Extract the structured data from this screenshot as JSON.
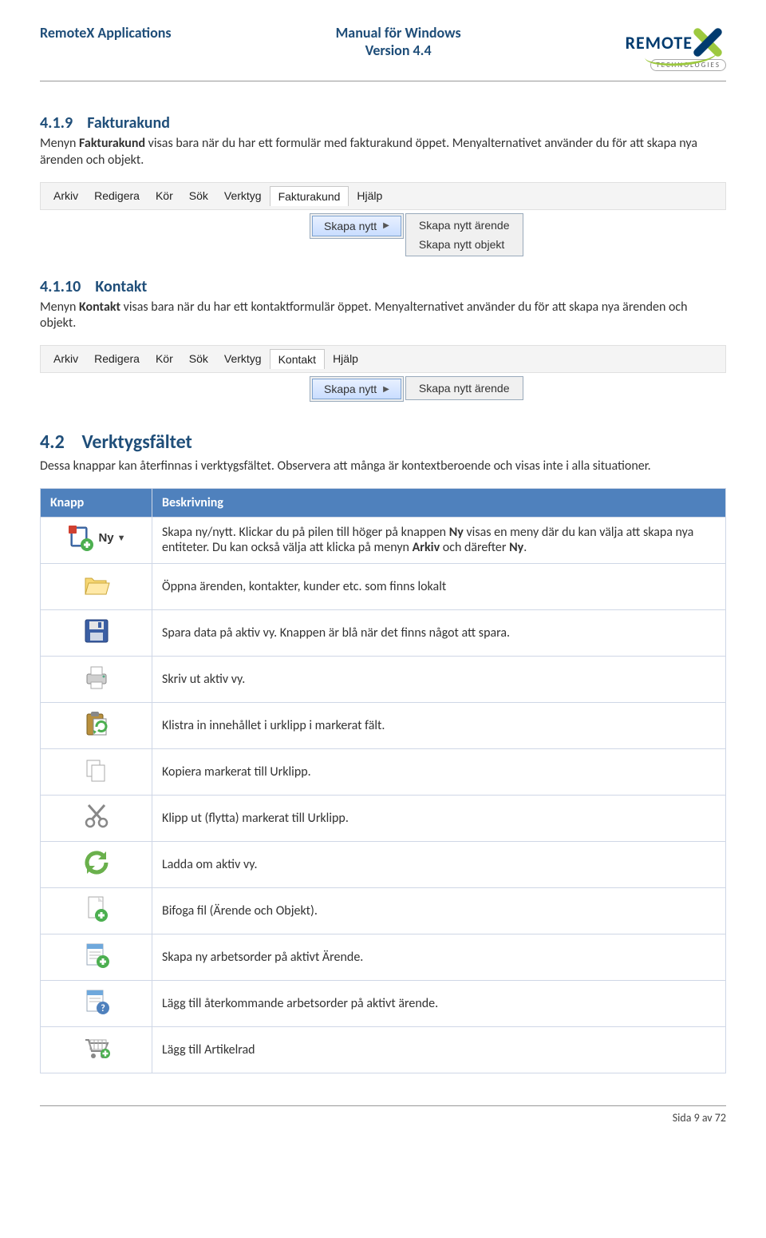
{
  "header": {
    "left": "RemoteX Applications",
    "center_line1": "Manual för Windows",
    "center_line2": "Version 4.4",
    "brand": "REMOTE",
    "brand_tag": "TECHNOLOGIES"
  },
  "sections": {
    "s1_num": "4.1.9",
    "s1_title": "Fakturakund",
    "s1_body_a": "Menyn ",
    "s1_body_b": "Fakturakund",
    "s1_body_c": " visas bara när du har ett formulär med fakturakund öppet. Menyalternativet använder du för att skapa nya ärenden och objekt.",
    "s2_num": "4.1.10",
    "s2_title": "Kontakt",
    "s2_body_a": "Menyn ",
    "s2_body_b": "Kontakt",
    "s2_body_c": " visas bara när du har ett kontaktformulär öppet. Menyalternativet använder du för att skapa nya ärenden och objekt.",
    "s3_num": "4.2",
    "s3_title": "Verktygsfältet",
    "s3_body": "Dessa knappar kan återfinnas i verktygsfältet. Observera att många är kontextberoende och visas inte i alla situationer."
  },
  "menus": {
    "items": [
      "Arkiv",
      "Redigera",
      "Kör",
      "Sök",
      "Verktyg"
    ],
    "fakturakund": "Fakturakund",
    "kontakt": "Kontakt",
    "hjalp": "Hjälp",
    "skapa_nytt": "Skapa nytt",
    "sub_arende": "Skapa nytt ärende",
    "sub_objekt": "Skapa nytt objekt"
  },
  "table": {
    "h1": "Knapp",
    "h2": "Beskrivning",
    "rows": [
      {
        "icon": "new",
        "label": "Ny",
        "text": "Skapa ny/nytt. Klickar du på pilen till höger på knappen ",
        "bold": "Ny",
        "text2": " visas en meny där du kan välja att skapa nya entiteter. Du kan också välja att klicka på menyn ",
        "bold2": "Arkiv",
        "text3": " och därefter ",
        "bold3": "Ny",
        "text4": "."
      },
      {
        "icon": "open",
        "text": "Öppna ärenden, kontakter, kunder etc. som finns lokalt"
      },
      {
        "icon": "save",
        "text": "Spara data på aktiv vy. Knappen är blå när det finns något att spara."
      },
      {
        "icon": "print",
        "text": "Skriv ut aktiv vy."
      },
      {
        "icon": "paste",
        "text": "Klistra in innehållet i urklipp i markerat fält."
      },
      {
        "icon": "copy",
        "text": "Kopiera markerat till Urklipp."
      },
      {
        "icon": "cut",
        "text": "Klipp ut (flytta) markerat till Urklipp."
      },
      {
        "icon": "reload",
        "text": "Ladda om aktiv vy."
      },
      {
        "icon": "attach",
        "text": "Bifoga fil (Ärende och Objekt)."
      },
      {
        "icon": "workorder",
        "text": "Skapa ny arbetsorder på aktivt Ärende."
      },
      {
        "icon": "recurring",
        "text": "Lägg till återkommande arbetsorder på aktivt ärende."
      },
      {
        "icon": "cart",
        "text": "Lägg till Artikelrad"
      }
    ]
  },
  "footer": "Sida 9 av 72"
}
